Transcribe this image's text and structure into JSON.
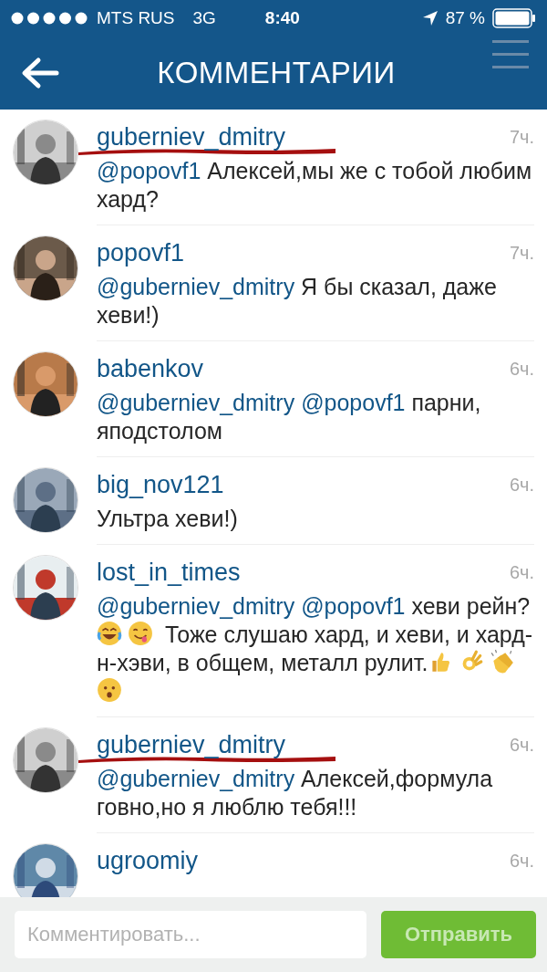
{
  "status_bar": {
    "carrier": "MTS RUS",
    "network": "3G",
    "time": "8:40",
    "battery": "87 %"
  },
  "header": {
    "title": "КОММЕНТАРИИ"
  },
  "comments": [
    {
      "username": "guberniev_dmitry",
      "underlined": true,
      "time": "7ч.",
      "avatar": {
        "kind": "picture"
      },
      "segments": [
        {
          "kind": "mention",
          "text": "@popovf1"
        },
        {
          "kind": "text",
          "text": " Алексей,мы же с тобой любим хард?"
        }
      ]
    },
    {
      "username": "popovf1",
      "underlined": false,
      "time": "7ч.",
      "avatar": {
        "kind": "picture"
      },
      "segments": [
        {
          "kind": "mention",
          "text": "@guberniev_dmitry"
        },
        {
          "kind": "text",
          "text": " Я бы сказал, даже хеви!)"
        }
      ]
    },
    {
      "username": "babenkov",
      "underlined": false,
      "time": "6ч.",
      "avatar": {
        "kind": "picture"
      },
      "segments": [
        {
          "kind": "mention",
          "text": "@guberniev_dmitry"
        },
        {
          "kind": "mention",
          "text": "@popovf1"
        },
        {
          "kind": "text",
          "text": " парни, яподстолом"
        }
      ]
    },
    {
      "username": "big_nov121",
      "underlined": false,
      "time": "6ч.",
      "avatar": {
        "kind": "picture"
      },
      "segments": [
        {
          "kind": "text",
          "text": "Ультра хеви!)"
        }
      ]
    },
    {
      "username": "lost_in_times",
      "underlined": false,
      "time": "6ч.",
      "avatar": {
        "kind": "picture"
      },
      "segments": [
        {
          "kind": "mention",
          "text": "@guberniev_dmitry"
        },
        {
          "kind": "mention",
          "text": "@popovf1"
        },
        {
          "kind": "text",
          "text": " хеви рейн? "
        },
        {
          "kind": "laugh"
        },
        {
          "kind": "yum"
        },
        {
          "kind": "text",
          "text": " Тоже слушаю хард, и хеви, и хард-н-хэви, в общем, металл рулит."
        },
        {
          "kind": "thumbs"
        },
        {
          "kind": "ok"
        },
        {
          "kind": "clap"
        },
        {
          "kind": "hushed"
        }
      ]
    },
    {
      "username": "guberniev_dmitry",
      "underlined": true,
      "time": "6ч.",
      "avatar": {
        "kind": "picture"
      },
      "segments": [
        {
          "kind": "mention",
          "text": "@guberniev_dmitry"
        },
        {
          "kind": "text",
          "text": " Алексей,формула говно,но я люблю тебя!!!"
        }
      ]
    },
    {
      "username": "ugroomiy",
      "underlined": false,
      "time": "6ч.",
      "avatar": {
        "kind": "picture"
      }
    }
  ],
  "composer": {
    "placeholder": "Комментировать...",
    "button": "Отправить"
  }
}
